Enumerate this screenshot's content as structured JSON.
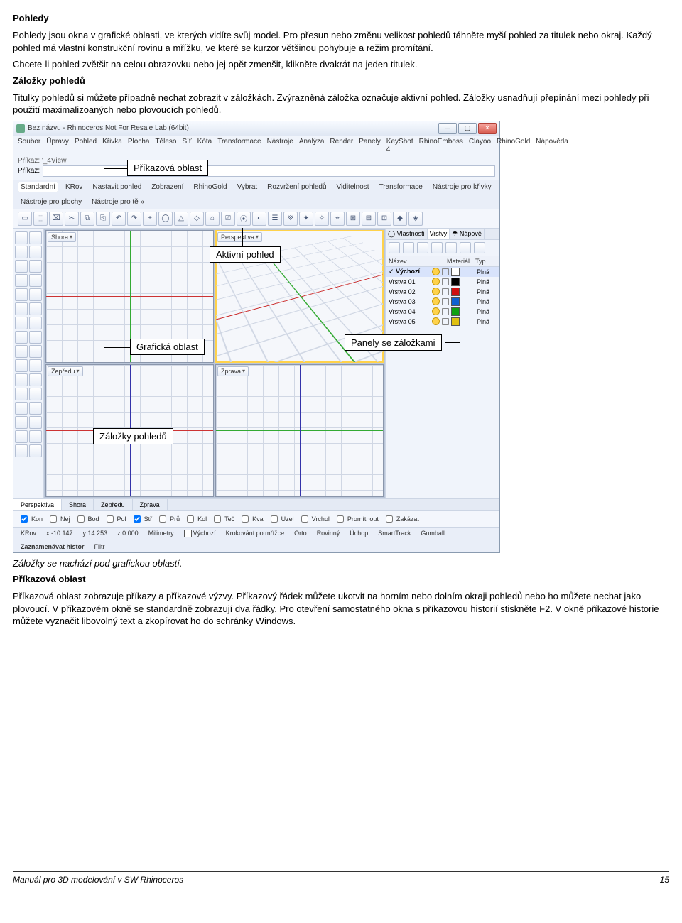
{
  "doc": {
    "h_pohledy": "Pohledy",
    "p1": "Pohledy jsou okna v grafické oblasti, ve kterých vidíte svůj model. Pro přesun nebo změnu velikost pohledů táhněte myší pohled za titulek nebo okraj. Každý pohled má vlastní konstrukční rovinu a mřížku, ve které se kurzor většinou pohybuje a režim promítání.",
    "p2": "Chcete-li pohled zvětšit na celou obrazovku nebo jej opět zmenšit, klikněte dvakrát na jeden titulek.",
    "h_zalozky": "Záložky pohledů",
    "p3": "Titulky pohledů si můžete případně nechat zobrazit v záložkách. Zvýrazněná záložka označuje aktivní pohled. Záložky usnadňují přepínání mezi pohledy při použití maximalizoaných nebo plovoucích pohledů.",
    "p_caption": "Záložky se nachází pod grafickou oblastí.",
    "h_prikaz": "Příkazová oblast",
    "p4": "Příkazová oblast zobrazuje příkazy a příkazové výzvy. Příkazový řádek můžete ukotvit na horním nebo dolním okraji pohledů nebo ho můžete nechat jako plovoucí. V příkazovém okně se standardně zobrazují dva řádky. Pro otevření samostatného okna s příkazovou historií stiskněte F2. V okně příkazové historie můžete vyznačit libovolný text a zkopírovat ho do schránky Windows."
  },
  "ann": {
    "a_cmd": "Příkazová oblast",
    "a_active": "Aktivní pohled",
    "a_gfx": "Grafická oblast",
    "a_panels": "Panely se záložkami",
    "a_tabs": "Záložky pohledů"
  },
  "shot": {
    "title": "Bez názvu - Rhinoceros Not For Resale Lab (64bit)",
    "menu": [
      "Soubor",
      "Úpravy",
      "Pohled",
      "Křivka",
      "Plocha",
      "Těleso",
      "Síť",
      "Kóta",
      "Transformace",
      "Nástroje",
      "Analýza",
      "Render",
      "Panely",
      "KeyShot 4",
      "RhinoEmboss",
      "Clayoo",
      "RhinoGold",
      "Nápověda"
    ],
    "cmd_history": "Příkaz: '_4View",
    "cmd_label": "Příkaz:",
    "tooltabs": [
      "Standardní",
      "KRov",
      "Nastavit pohled",
      "Zobrazení",
      "RhinoGold",
      "Vybrat",
      "Rozvržení pohledů",
      "Viditelnost",
      "Transformace",
      "Nástroje pro křivky",
      "Nástroje pro plochy",
      "Nástroje pro tě »"
    ],
    "viewports": {
      "tl": "Shora",
      "tr": "Perspektiva",
      "bl": "Zepředu",
      "br": "Zprava"
    },
    "panel_tabs": [
      "◯ Vlastnosti",
      "Vrstvy",
      "☂ Nápově"
    ],
    "layer_head": {
      "name": "Název",
      "mat": "Materiál",
      "typ": "Typ"
    },
    "layers": [
      {
        "name": "Výchozí",
        "sw": "#ffffff",
        "typ": "Plná",
        "sel": true,
        "check": true
      },
      {
        "name": "Vrstva 01",
        "sw": "#000000",
        "typ": "Plná"
      },
      {
        "name": "Vrstva 02",
        "sw": "#d01010",
        "typ": "Plná"
      },
      {
        "name": "Vrstva 03",
        "sw": "#1060d0",
        "typ": "Plná"
      },
      {
        "name": "Vrstva 04",
        "sw": "#10a010",
        "typ": "Plná"
      },
      {
        "name": "Vrstva 05",
        "sw": "#e0c010",
        "typ": "Plná"
      }
    ],
    "vtabs": [
      "Perspektiva",
      "Shora",
      "Zepředu",
      "Zprava"
    ],
    "osnap": [
      "Kon",
      "Nej",
      "Bod",
      "Pol",
      "Stř",
      "Prů",
      "Kol",
      "Teč",
      "Kva",
      "Uzel",
      "Vrchol",
      "Promítnout",
      "Zakázat"
    ],
    "status": {
      "cplane": "KRov",
      "x": "x -10.147",
      "y": "y 14.253",
      "z": "z 0.000",
      "units": "Milimetry",
      "layer": "Výchozí",
      "snap": "Krokování po mřížce",
      "ortho": "Orto",
      "planar": "Rovinný",
      "osnap": "Úchop",
      "smart": "SmartTrack",
      "gumball": "Gumball",
      "rec": "Zaznamenávat histor",
      "filter": "Filtr"
    }
  },
  "footer": {
    "left": "Manuál pro 3D modelování v SW Rhinoceros",
    "right": "15"
  }
}
